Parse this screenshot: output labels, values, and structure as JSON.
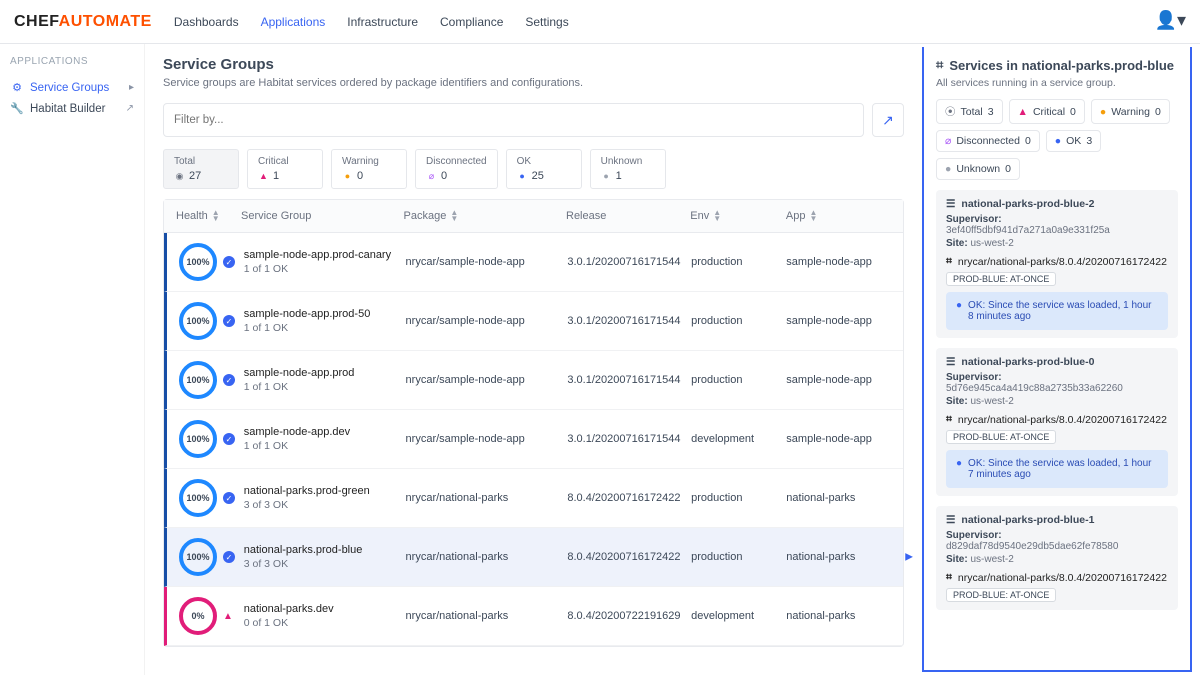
{
  "logo": {
    "part1": "CHEF",
    "part2": "AUTOMATE"
  },
  "nav": [
    "Dashboards",
    "Applications",
    "Infrastructure",
    "Compliance",
    "Settings"
  ],
  "nav_active": 1,
  "sidebar": {
    "header": "APPLICATIONS",
    "items": [
      {
        "icon": "⚙",
        "label": "Service Groups",
        "tail": "▸",
        "active": true
      },
      {
        "icon": "🔧",
        "label": "Habitat Builder",
        "tail": "↗",
        "active": false
      }
    ]
  },
  "page": {
    "title": "Service Groups",
    "subtitle": "Service groups are Habitat services ordered by package identifiers and configurations.",
    "filter_placeholder": "Filter by..."
  },
  "stats": [
    {
      "label": "Total",
      "value": "27",
      "icon": "◉",
      "color": "#6b7280",
      "active": true
    },
    {
      "label": "Critical",
      "value": "1",
      "icon": "▲",
      "color": "#e11d79"
    },
    {
      "label": "Warning",
      "value": "0",
      "icon": "●",
      "color": "#f59e0b"
    },
    {
      "label": "Disconnected",
      "value": "0",
      "icon": "⌀",
      "color": "#a855f7"
    },
    {
      "label": "OK",
      "value": "25",
      "icon": "●",
      "color": "#3864f2"
    },
    {
      "label": "Unknown",
      "value": "1",
      "icon": "●",
      "color": "#9ca3af"
    }
  ],
  "columns": [
    "Health",
    "Service Group",
    "Package",
    "Release",
    "Env",
    "App"
  ],
  "rows": [
    {
      "pct": "100%",
      "status": "ok",
      "name": "sample-node-app.prod-canary",
      "count": "1 of 1 OK",
      "pkg": "nrycar/sample-node-app",
      "rel": "3.0.1/20200716171544",
      "env": "production",
      "app": "sample-node-app"
    },
    {
      "pct": "100%",
      "status": "ok",
      "name": "sample-node-app.prod-50",
      "count": "1 of 1 OK",
      "pkg": "nrycar/sample-node-app",
      "rel": "3.0.1/20200716171544",
      "env": "production",
      "app": "sample-node-app"
    },
    {
      "pct": "100%",
      "status": "ok",
      "name": "sample-node-app.prod",
      "count": "1 of 1 OK",
      "pkg": "nrycar/sample-node-app",
      "rel": "3.0.1/20200716171544",
      "env": "production",
      "app": "sample-node-app"
    },
    {
      "pct": "100%",
      "status": "ok",
      "name": "sample-node-app.dev",
      "count": "1 of 1 OK",
      "pkg": "nrycar/sample-node-app",
      "rel": "3.0.1/20200716171544",
      "env": "development",
      "app": "sample-node-app"
    },
    {
      "pct": "100%",
      "status": "ok",
      "name": "national-parks.prod-green",
      "count": "3 of 3 OK",
      "pkg": "nrycar/national-parks",
      "rel": "8.0.4/20200716172422",
      "env": "production",
      "app": "national-parks"
    },
    {
      "pct": "100%",
      "status": "ok",
      "name": "national-parks.prod-blue",
      "count": "3 of 3 OK",
      "pkg": "nrycar/national-parks",
      "rel": "8.0.4/20200716172422",
      "env": "production",
      "app": "national-parks",
      "selected": true
    },
    {
      "pct": "0%",
      "status": "crit",
      "name": "national-parks.dev",
      "count": "0 of 1 OK",
      "pkg": "nrycar/national-parks",
      "rel": "8.0.4/20200722191629",
      "env": "development",
      "app": "national-parks"
    }
  ],
  "panel": {
    "title": "Services in national-parks.prod-blue",
    "subtitle": "All services running in a service group.",
    "chips": [
      {
        "icon": "⦿",
        "color": "#6b7280",
        "label": "Total",
        "val": "3"
      },
      {
        "icon": "▲",
        "color": "#e11d79",
        "label": "Critical",
        "val": "0"
      },
      {
        "icon": "●",
        "color": "#f59e0b",
        "label": "Warning",
        "val": "0"
      },
      {
        "icon": "⌀",
        "color": "#a855f7",
        "label": "Disconnected",
        "val": "0"
      },
      {
        "icon": "●",
        "color": "#3864f2",
        "label": "OK",
        "val": "3"
      },
      {
        "icon": "●",
        "color": "#9ca3af",
        "label": "Unknown",
        "val": "0"
      }
    ],
    "services": [
      {
        "name": "national-parks-prod-blue-2",
        "supervisor": "3ef40ff5dbf941d7a271a0a9e331f25a",
        "site": "us-west-2",
        "pkg": "nrycar/national-parks/8.0.4/20200716172422",
        "tag": "PROD-BLUE: AT-ONCE",
        "ok": "OK: Since the service was loaded, 1 hour 8 minutes ago"
      },
      {
        "name": "national-parks-prod-blue-0",
        "supervisor": "5d76e945ca4a419c88a2735b33a62260",
        "site": "us-west-2",
        "pkg": "nrycar/national-parks/8.0.4/20200716172422",
        "tag": "PROD-BLUE: AT-ONCE",
        "ok": "OK: Since the service was loaded, 1 hour 7 minutes ago"
      },
      {
        "name": "national-parks-prod-blue-1",
        "supervisor": "d829daf78d9540e29db5dae62fe78580",
        "site": "us-west-2",
        "pkg": "nrycar/national-parks/8.0.4/20200716172422",
        "tag": "PROD-BLUE: AT-ONCE"
      }
    ],
    "labels": {
      "supervisor": "Supervisor:",
      "site": "Site:"
    }
  }
}
